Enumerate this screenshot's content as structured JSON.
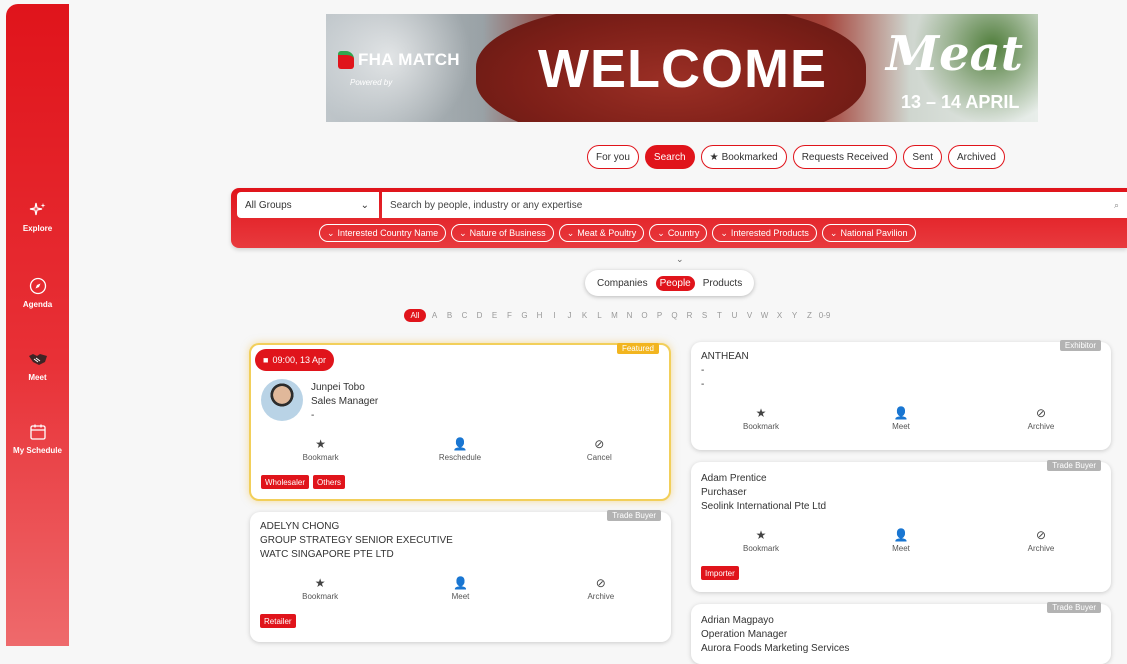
{
  "sidebar": {
    "items": [
      {
        "label": "Explore",
        "icon": "sparkles-icon"
      },
      {
        "label": "Agenda",
        "icon": "compass-icon"
      },
      {
        "label": "Meet",
        "icon": "handshake-icon"
      },
      {
        "label": "My Schedule",
        "icon": "calendar-icon"
      }
    ]
  },
  "banner": {
    "logo": "FHA MATCH",
    "powered": "Powered by",
    "welcome": "WELCOME",
    "meat": "Meat",
    "dates": "13 – 14 APRIL"
  },
  "tabs": [
    "For you",
    "Search",
    "Bookmarked",
    "Requests Received",
    "Sent",
    "Archived"
  ],
  "search": {
    "group": "All Groups",
    "placeholder": "Search by people, industry or any expertise"
  },
  "facets": [
    "Interested Country Name",
    "Nature of Business",
    "Meat & Poultry",
    "Country",
    "Interested Products",
    "National Pavilion"
  ],
  "switcher": [
    "Companies",
    "People",
    "Products"
  ],
  "alphabet": [
    "All",
    "A",
    "B",
    "C",
    "D",
    "E",
    "F",
    "G",
    "H",
    "I",
    "J",
    "K",
    "L",
    "M",
    "N",
    "O",
    "P",
    "Q",
    "R",
    "S",
    "T",
    "U",
    "V",
    "W",
    "X",
    "Y",
    "Z",
    "0-9"
  ],
  "cards": {
    "c1": {
      "tag": "Featured",
      "slot": "09:00, 13 Apr",
      "name": "Junpei Tobo",
      "role": "Sales Manager",
      "company": "-",
      "actions": [
        "Bookmark",
        "Reschedule",
        "Cancel"
      ],
      "chips": [
        "Wholesaler",
        "Others"
      ]
    },
    "c2": {
      "tag": "Exhibitor",
      "name": "ANTHEAN",
      "role": "-",
      "company": "-",
      "actions": [
        "Bookmark",
        "Meet",
        "Archive"
      ]
    },
    "c3": {
      "tag": "Trade Buyer",
      "name": "ADELYN CHONG",
      "role": "GROUP STRATEGY SENIOR EXECUTIVE",
      "company": "WATC SINGAPORE PTE LTD",
      "actions": [
        "Bookmark",
        "Meet",
        "Archive"
      ],
      "chips": [
        "Retailer"
      ]
    },
    "c4": {
      "tag": "Trade Buyer",
      "name": "Adam Prentice",
      "role": "Purchaser",
      "company": "Seolink International Pte Ltd",
      "actions": [
        "Bookmark",
        "Meet",
        "Archive"
      ],
      "chips": [
        "Importer"
      ]
    },
    "c5": {
      "tag": "Trade Buyer",
      "name": "Adrian Magpayo",
      "role": "Operation Manager",
      "company": "Aurora Foods Marketing Services"
    }
  },
  "colors": {
    "brand": "#e0141b",
    "featured": "#f2cf5a"
  }
}
